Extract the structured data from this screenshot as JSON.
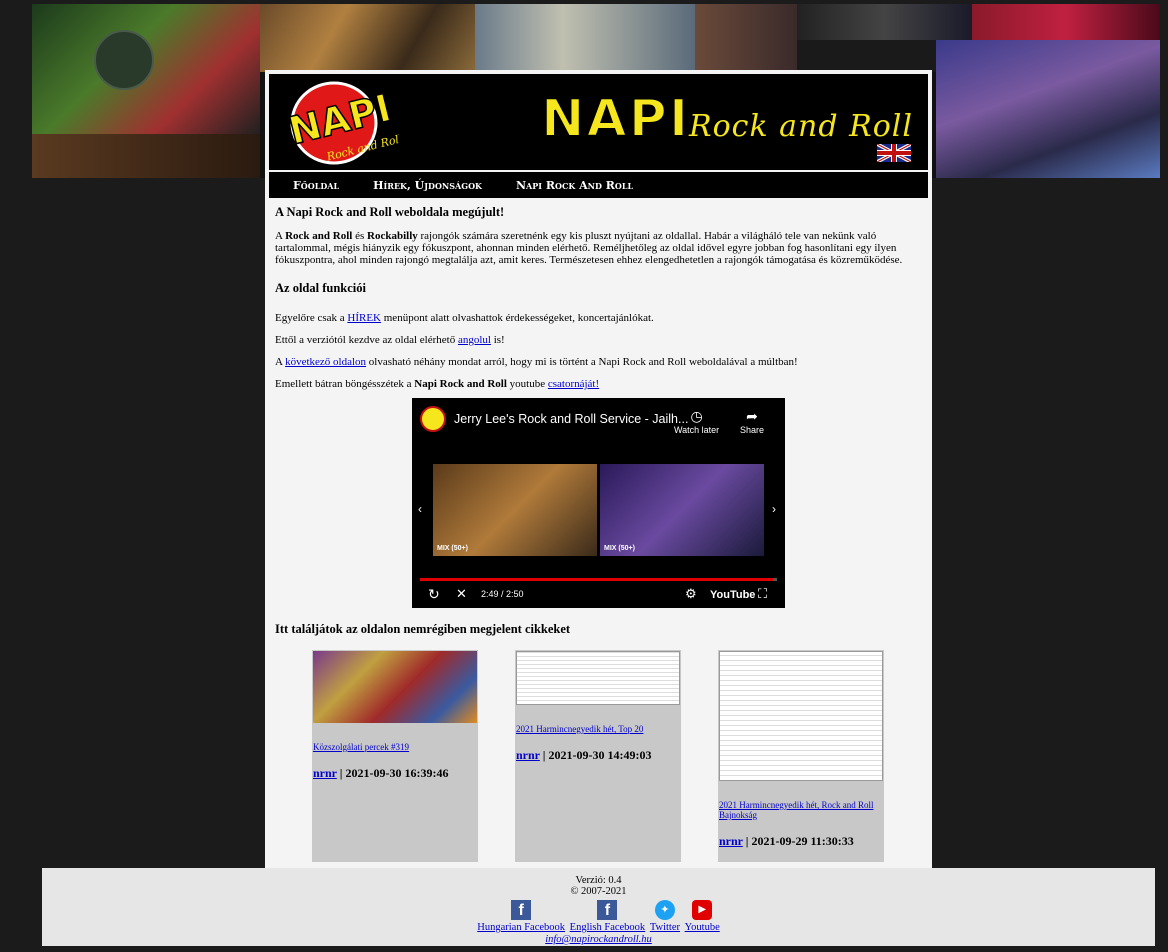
{
  "header": {
    "logo_text": "NAPI",
    "logo_sub": "Rock and Roll",
    "title_main": "NAPI",
    "title_sub": "Rock and Roll",
    "lang_flag": "uk-flag-icon"
  },
  "nav": {
    "items": [
      "Főoldal",
      "Hírek, Újdonságok",
      "Napi Rock And Roll"
    ]
  },
  "content": {
    "heading1": "A Napi Rock and Roll weboldala megújult!",
    "p1_pre": "A ",
    "p1_b1": "Rock and Roll",
    "p1_mid": " és ",
    "p1_b2": "Rockabilly",
    "p1_post": " rajongók számára szeretnénk egy kis pluszt nyújtani az oldallal. Habár a világháló tele van nekünk való tartalommal, mégis hiányzik egy fókuszpont, ahonnan minden elérhető. Reméljhetőleg az oldal idővel egyre jobban fog hasonlítani egy ilyen fókuszpontra, ahol minden rajongó megtalálja azt, amit keres. Természetesen ehhez elengedhetetlen a rajongók támogatása és közreműködése.",
    "heading2": "Az oldal funkciói",
    "p2_pre": "Egyelőre csak a ",
    "p2_link": "HÍREK",
    "p2_post": " menüpont alatt olvashattok érdekességeket, koncertajánlókat.",
    "p3_pre": "Ettől a verziótól kezdve az oldal elérhető ",
    "p3_link": "angolul",
    "p3_post": " is!",
    "p4_pre": "A ",
    "p4_link": "következő oldalon",
    "p4_post": " olvasható néhány mondat arról, hogy mi is történt a Napi Rock and Roll weboldalával a múltban!",
    "p5_pre": "Emellett bátran böngésszétek a ",
    "p5_b": "Napi Rock and Roll",
    "p5_mid": " youtube ",
    "p5_link": "csatornáját!"
  },
  "video": {
    "title": "Jerry Lee's Rock and Roll Service - Jailh...",
    "watch_later": "Watch later",
    "share": "Share",
    "mix1": "MIX (50+)",
    "mix2": "MIX (50+)",
    "time": "2:49 / 2:50",
    "progress": 0.99,
    "brand": "YouTube"
  },
  "articles": {
    "title": "Itt találjátok az oldalon nemrégiben megjelent cikkeket",
    "items": [
      {
        "link": "Közszolgálati percek #319",
        "author": "nrnr",
        "date": "2021-09-30 16:39:46"
      },
      {
        "link": "2021 Harmincnegyedik hét, Top 20",
        "author": "nrnr",
        "date": "2021-09-30 14:49:03"
      },
      {
        "link": "2021 Harmincnegyedik hét, Rock and Roll Bajnokság",
        "author": "nrnr",
        "date": "2021-09-29 11:30:33"
      }
    ]
  },
  "footer": {
    "version": "Verzió: 0.4",
    "copyright": "© 2007-2021",
    "links": [
      "Hungarian Facebook",
      "English Facebook",
      "Twitter",
      "Youtube"
    ],
    "email": "info@napirockandroll.hu"
  },
  "colors": {
    "accent_yellow": "#f5e61e",
    "link_blue": "#0000cc",
    "youtube_red": "#e00000"
  }
}
